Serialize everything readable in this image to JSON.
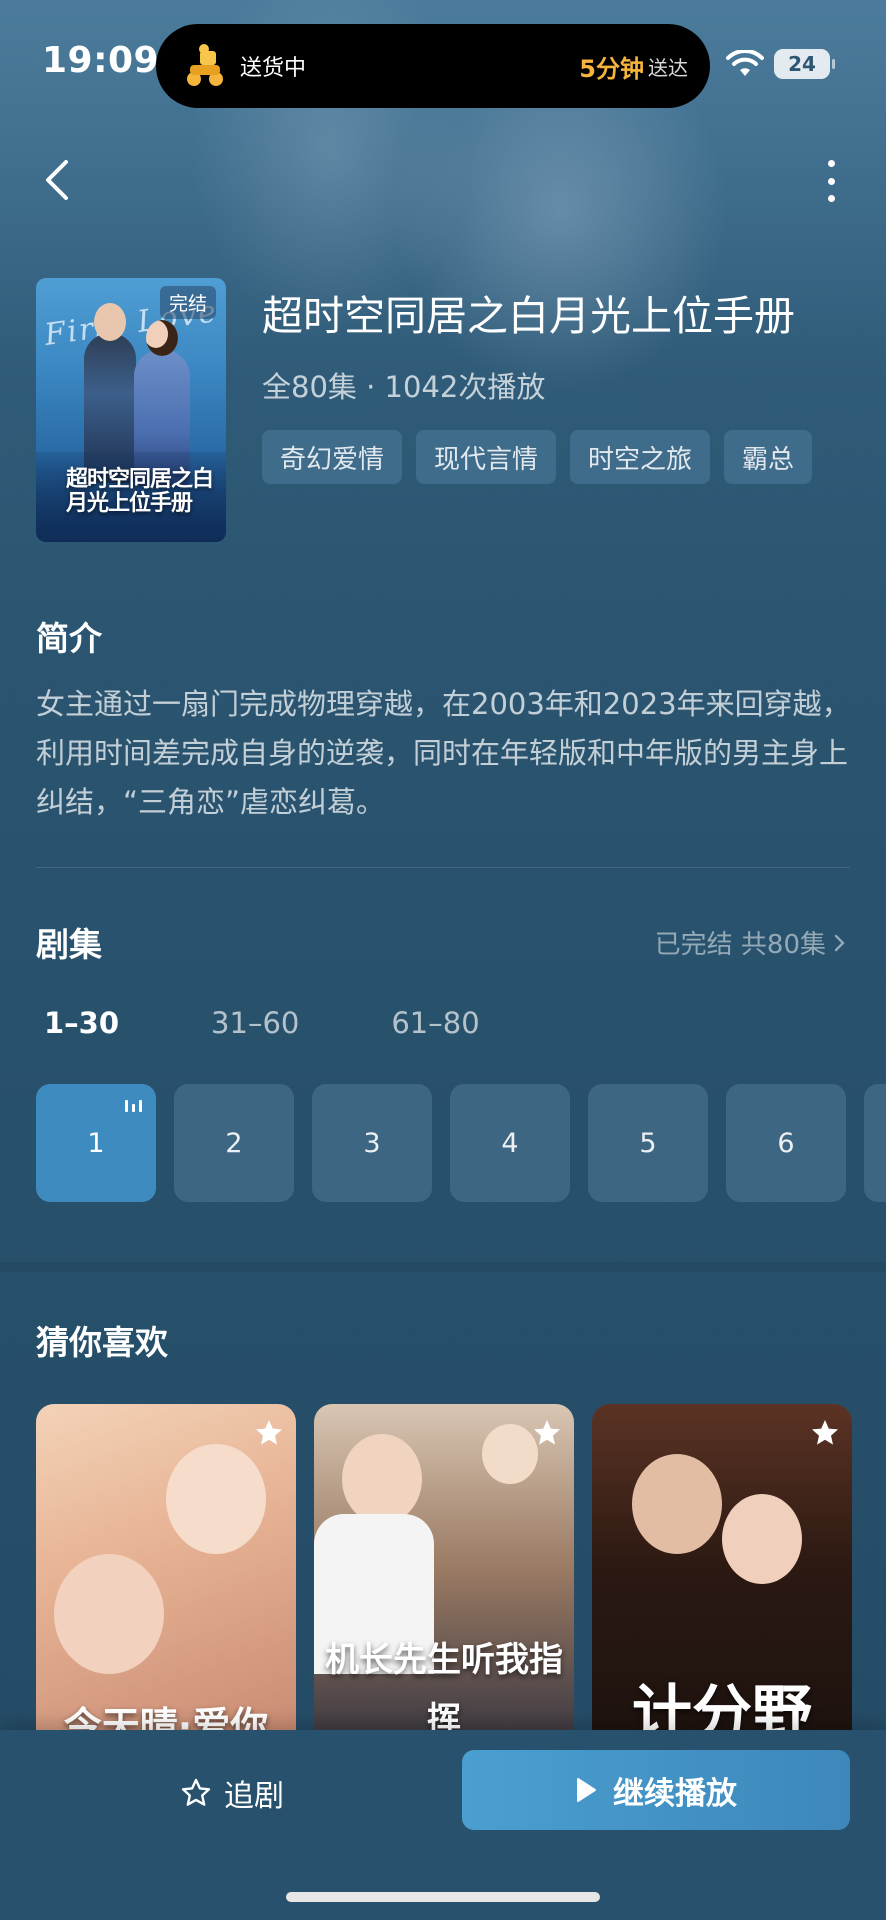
{
  "status_bar": {
    "time": "19:09",
    "island_status": "送货中",
    "island_eta": "5分钟",
    "island_eta_suffix": "送达",
    "battery": "24"
  },
  "drama": {
    "poster_badge": "完结",
    "poster_script": "First Love",
    "poster_title": "超时空同居之白月光上位手册",
    "title": "超时空同居之白月光上位手册",
    "meta": "全80集 · 1042次播放",
    "tags": [
      "奇幻爱情",
      "现代言情",
      "时空之旅",
      "霸总"
    ]
  },
  "synopsis": {
    "heading": "简介",
    "text": "女主通过一扇门完成物理穿越，在2003年和2023年来回穿越，利用时间差完成自身的逆袭，同时在年轻版和中年版的男主身上纠结，“三角恋”虐恋纠葛。"
  },
  "episodes": {
    "heading": "剧集",
    "status": "已完结 共80集",
    "ranges": [
      "1–30",
      "31–60",
      "61–80"
    ],
    "active_range": 0,
    "items": [
      "1",
      "2",
      "3",
      "4",
      "5",
      "6"
    ],
    "playing_index": 0
  },
  "recommend": {
    "heading": "猜你喜欢",
    "items": [
      {
        "poster_text": "今天晴·爱你"
      },
      {
        "poster_text": "机长先生听我指挥"
      },
      {
        "poster_text": "计分野"
      }
    ]
  },
  "actions": {
    "follow_label": "追剧",
    "play_label": "继续播放"
  },
  "colors": {
    "accent": "#3e8bc0",
    "eta": "#f5b43c",
    "background": "#27506b"
  }
}
